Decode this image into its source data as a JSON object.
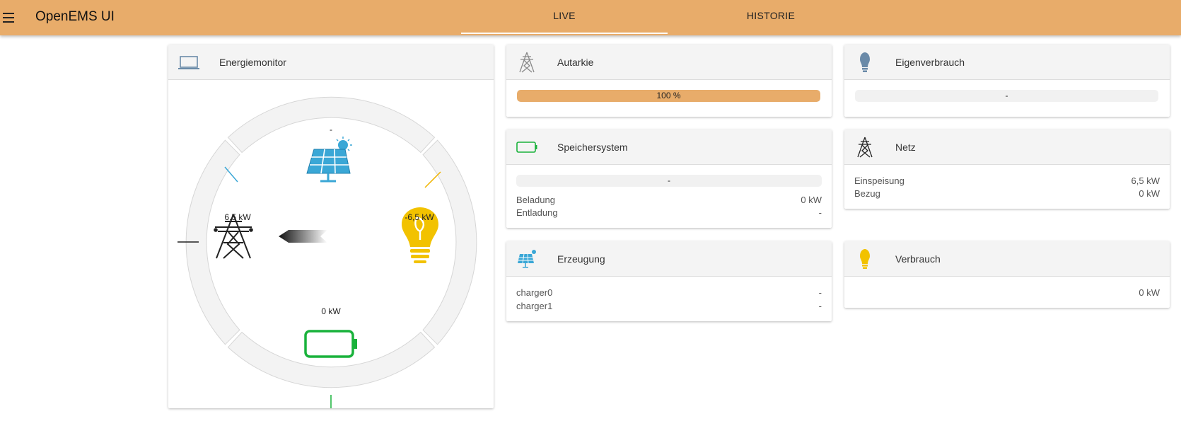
{
  "app": {
    "title": "OpenEMS UI",
    "menu_icon": "menu-icon"
  },
  "tabs": [
    {
      "label": "LIVE",
      "active": true
    },
    {
      "label": "HISTORIE",
      "active": false
    }
  ],
  "colors": {
    "accent": "#e8ac6a",
    "grid": "#222222",
    "consumption": "#f2c200",
    "storage": "#19b23b",
    "production": "#3aa7d6"
  },
  "energymonitor": {
    "title": "Energiemonitor",
    "icon": "laptop-icon",
    "production_value": "-",
    "grid_value": "6,5 kW",
    "consumption_value": "-6,5 kW",
    "storage_value": "0 kW"
  },
  "autarkie": {
    "title": "Autarkie",
    "icon": "grid-tower-icon",
    "percent": 100,
    "label": "100 %"
  },
  "eigenverbrauch": {
    "title": "Eigenverbrauch",
    "icon": "lightbulb-icon",
    "label": "-"
  },
  "speichersystem": {
    "title": "Speichersystem",
    "icon": "battery-icon",
    "label": "-",
    "rows": [
      {
        "key": "Beladung",
        "value": "0 kW"
      },
      {
        "key": "Entladung",
        "value": "-"
      }
    ]
  },
  "netz": {
    "title": "Netz",
    "icon": "grid-tower-icon",
    "rows": [
      {
        "key": "Einspeisung",
        "value": "6,5 kW"
      },
      {
        "key": "Bezug",
        "value": "0 kW"
      }
    ]
  },
  "erzeugung": {
    "title": "Erzeugung",
    "icon": "solar-panel-icon",
    "rows": [
      {
        "key": "charger0",
        "value": "-"
      },
      {
        "key": "charger1",
        "value": "-"
      }
    ]
  },
  "verbrauch": {
    "title": "Verbrauch",
    "icon": "lightbulb-icon",
    "value": "0 kW"
  }
}
